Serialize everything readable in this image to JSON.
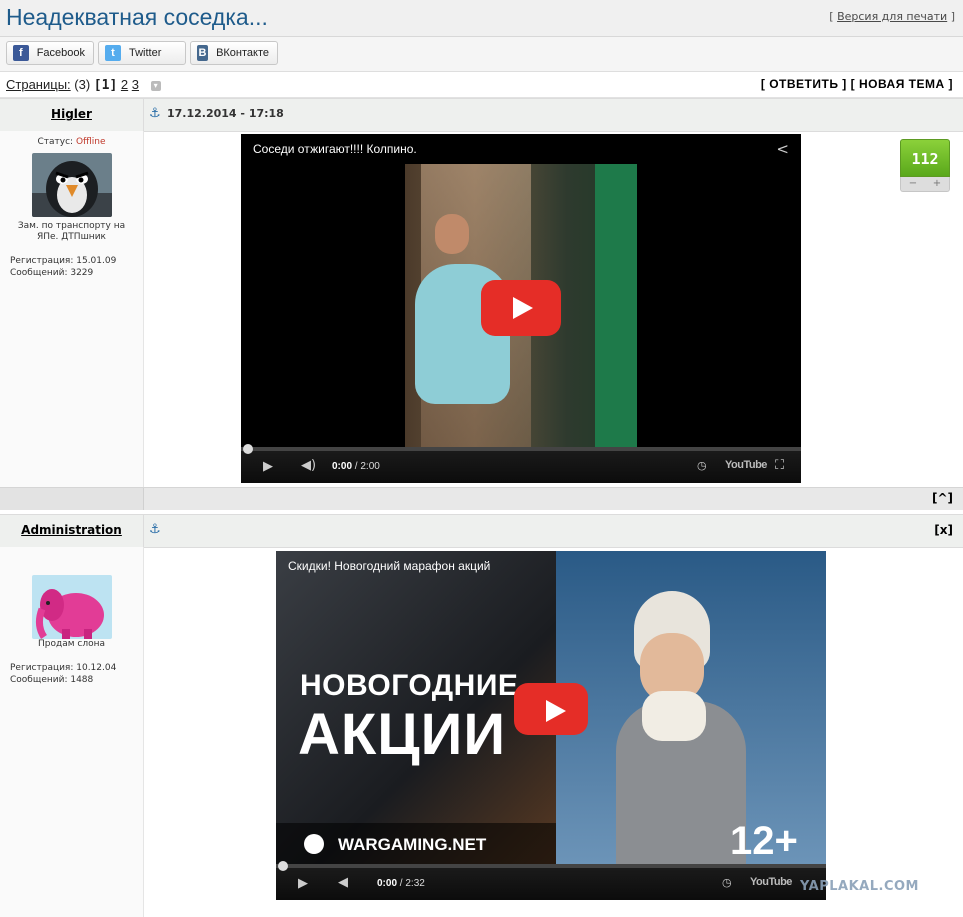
{
  "header": {
    "title": "Неадекватная соседка...",
    "print_open": "[",
    "print_link": "Версия для печати",
    "print_close": "]"
  },
  "share": [
    {
      "label": "Facebook",
      "icon": "facebook-icon",
      "glyph": "f",
      "color": "#3b5998"
    },
    {
      "label": "Twitter",
      "icon": "twitter-icon",
      "glyph": "t",
      "color": "#55acee"
    },
    {
      "label": "ВКонтакте",
      "icon": "vk-icon",
      "glyph": "B",
      "color": "#45688e"
    }
  ],
  "pages": {
    "label": "Страницы:",
    "count": "(3)",
    "current": "[1]",
    "p2": "2",
    "p3": "3"
  },
  "actions": {
    "reply": "[ ОТВЕТИТЬ ]",
    "new_topic": "[ НОВАЯ ТЕМА ]"
  },
  "posts": [
    {
      "user": "Higler",
      "date": "17.12.2014 - 17:18",
      "status_label": "Статус:",
      "status_value": "Offline",
      "rank": "Зам. по транспорту на ЯПе. ДТПшник",
      "reg": "Регистрация: 15.01.09",
      "msgs": "Сообщений: 3229",
      "video": {
        "title": "Соседи отжигают!!!! Колпино.",
        "current": "0:00",
        "duration": "/ 2:00",
        "brand": "YouTube"
      },
      "rating": "112",
      "vote_minus": "−",
      "vote_plus": "+",
      "up": "[^]"
    },
    {
      "user": "Administration",
      "close": "[x]",
      "rank": "Продам слона",
      "reg": "Регистрация: 10.12.04",
      "msgs": "Сообщений: 1488",
      "video": {
        "title": "Скидки! Новогодний марафон акций",
        "line1": "НОВОГОДНИЕ",
        "line2": "АКЦИИ",
        "brand_text": "WARGAMING.NET",
        "age": "12+",
        "current": "0:00",
        "duration": "/ 2:32",
        "brand": "YouTube"
      }
    }
  ],
  "watermark": "YAPLAKAL.COM"
}
